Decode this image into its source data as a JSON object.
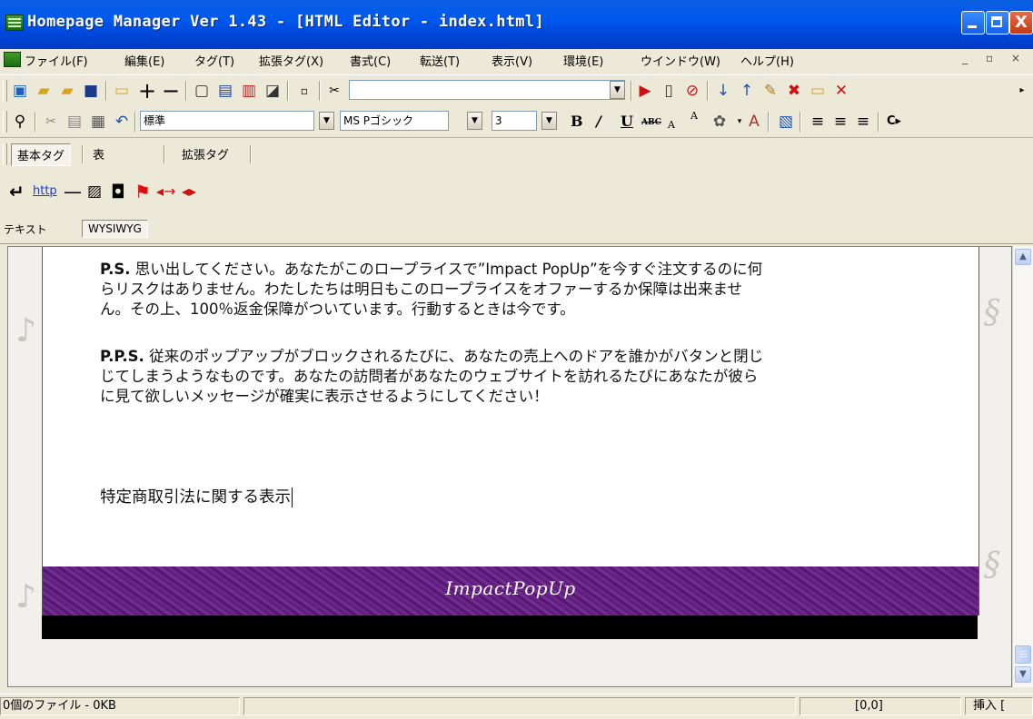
{
  "window": {
    "title": "Homepage Manager Ver 1.43 - [HTML Editor - index.html]",
    "close_glyph": "X"
  },
  "menu": {
    "items": [
      "ファイル(F)",
      "編集(E)",
      "タグ(T)",
      "拡張タグ(X)",
      "書式(C)",
      "転送(T)",
      "表示(V)",
      "環境(E)",
      "ウインドウ(W)",
      "ヘルプ(H)"
    ],
    "mdi_controls": "_ ▫ ×"
  },
  "toolbar2": {
    "style_combo": "標準",
    "font_combo": "MS Pゴシック",
    "size_combo": "3"
  },
  "tag_tabs": {
    "items": [
      "基本タグ",
      "表",
      "拡張タグ"
    ]
  },
  "icon_row": {
    "link_text": "http"
  },
  "mode_tabs": {
    "items": [
      "テキスト",
      "WYSIWYG"
    ]
  },
  "content": {
    "ps_label": "P.S.",
    "ps_lines": [
      " 思い出してください。あなたがこのロープライスで”Impact PopUp”を今すぐ注文するのに何",
      "らリスクはありません。わたしたちは明日もこのロープライスをオファーするか保障は出来ませ",
      "ん。その上、100％返金保障がついています。行動するときは今です。"
    ],
    "pps_label": "P.P.S.",
    "pps_lines": [
      " 従来のポップアップがブロックされるたびに、あなたの売上へのドアを誰かがバタンと閉じ",
      "じてしまうようなものです。あなたの訪問者があなたのウェブサイトを訪れるたびにあなたが彼ら",
      "に見て欲しいメッセージが確実に表示させるようにしてください！"
    ],
    "specific_trade": "特定商取引法に関する表示",
    "banner_text": "ImpactPopUp"
  },
  "status": {
    "files": "0個のファイル - 0KB",
    "position": "[0,0]",
    "mode": "挿入 ["
  },
  "colors": {
    "titlebar": "#0058ee",
    "banner": "#5b1a7a",
    "chrome": "#ece9d8"
  }
}
